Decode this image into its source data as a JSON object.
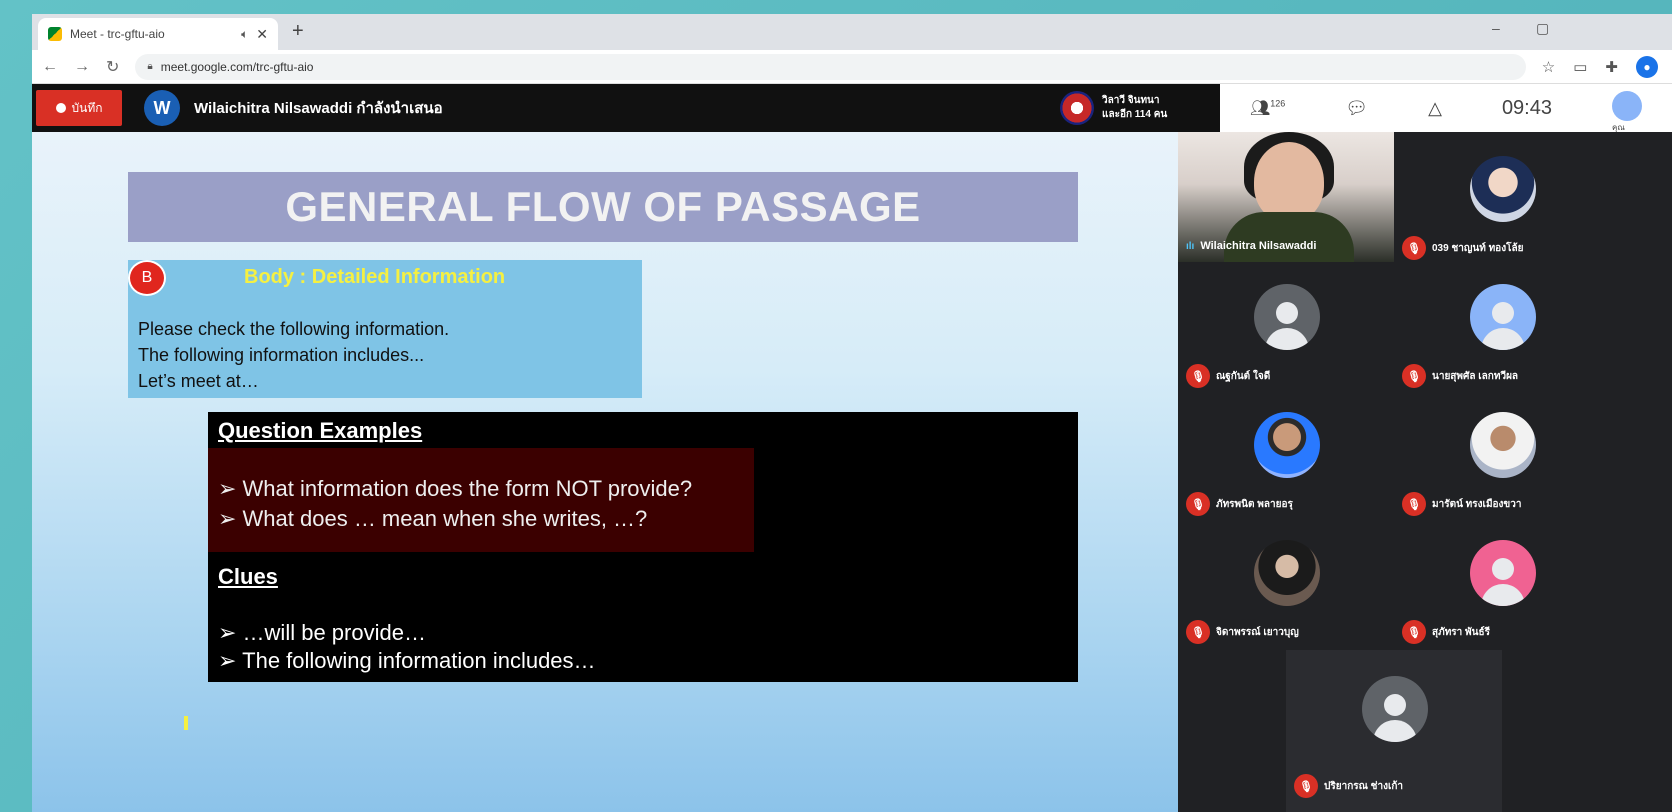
{
  "browser": {
    "tab_title": "Meet - trc-gftu-aio",
    "new_tab": "+",
    "window_min": "–",
    "window_max": "▢",
    "url": "meet.google.com/trc-gftu-aio"
  },
  "meet": {
    "record_label": "บันทึก",
    "presenter_initial": "W",
    "presenter_text": "Wilaichitra Nilsawaddi กำลังนำเสนอ",
    "host_line1": "วิลาวี จินทนา",
    "host_line2": "และอีก 114 คน",
    "participants_count": "126",
    "time": "09:43",
    "you_label": "คุณ"
  },
  "slide": {
    "title": "GENERAL FLOW OF PASSAGE",
    "badge": "B",
    "body_heading": "Body : Detailed Information",
    "body_lines": [
      "Please check the following information.",
      "The following information includes...",
      "Let’s meet at…"
    ],
    "question_heading": "Question Examples",
    "questions": [
      "➢ What information does the form NOT provide?",
      "➢ What does … mean when she writes, …?"
    ],
    "clues_heading": "Clues",
    "clues": [
      "➢ …will be provide…",
      "➢ The following information includes…"
    ]
  },
  "gallery": {
    "speaker_name": "Wilaichitra Nilsawaddi",
    "tiles": [
      {
        "name": "039 ชาญนท์ ทองโล้ย"
      },
      {
        "name": "ณฐกันต์ ใจดี"
      },
      {
        "name": "นายสุพศัล เลกทวีผล"
      },
      {
        "name": "ภัทรพนิต พลายอรุ"
      },
      {
        "name": "มารัตน์ ทรงเมืองขวา"
      },
      {
        "name": "จิดาพรรณ์ เยาวบุญ"
      },
      {
        "name": "สุภัทรา พันธ์รี"
      },
      {
        "name": "ปริยากรณ ช่างเก้า"
      }
    ]
  }
}
